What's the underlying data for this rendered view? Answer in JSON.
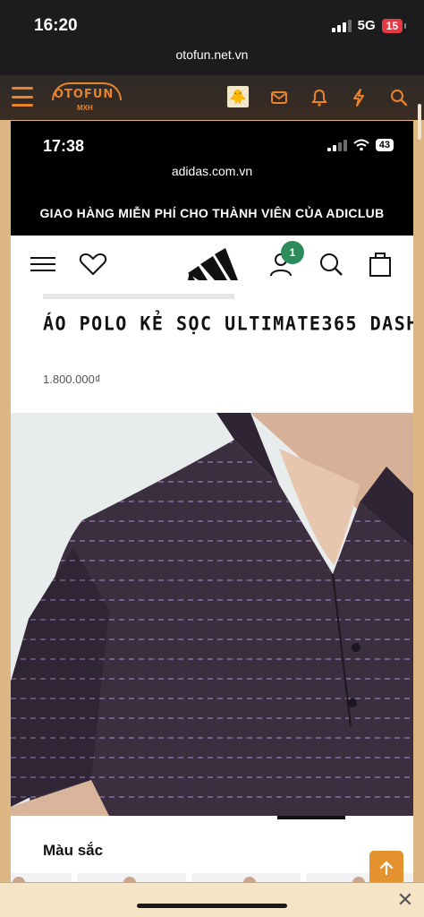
{
  "os_status": {
    "time": "16:20",
    "network": "5G",
    "battery": "15"
  },
  "browser": {
    "url": "otofun.net.vn"
  },
  "otofun": {
    "logo_text": "OTOFUN",
    "logo_sub": "MXH"
  },
  "screenshot": {
    "status": {
      "time": "17:38",
      "battery": "43"
    },
    "url": "adidas.com.vn",
    "promo": "GIAO HÀNG MIỄN PHÍ CHO THÀNH VIÊN CỦA ADICLUB",
    "cart_badge": "1",
    "product": {
      "title": "ÁO POLO KẺ SỌC ULTIMATE365 DASH",
      "price": "1.800.000₫",
      "color_label": "Màu sắc"
    }
  },
  "icons": {
    "otofun_menu": "hamburger-icon",
    "mail": "mail-icon",
    "bell": "bell-icon",
    "bolt": "lightning-icon",
    "search": "search-icon",
    "scroll_up": "arrow-up-icon",
    "close": "close-icon"
  },
  "colors": {
    "otofun_accent": "#e8832c",
    "frame_tan": "#dcb784",
    "badge_green": "#2e8b5b",
    "battery_red": "#e63946",
    "shirt": "#3b2f3f"
  }
}
